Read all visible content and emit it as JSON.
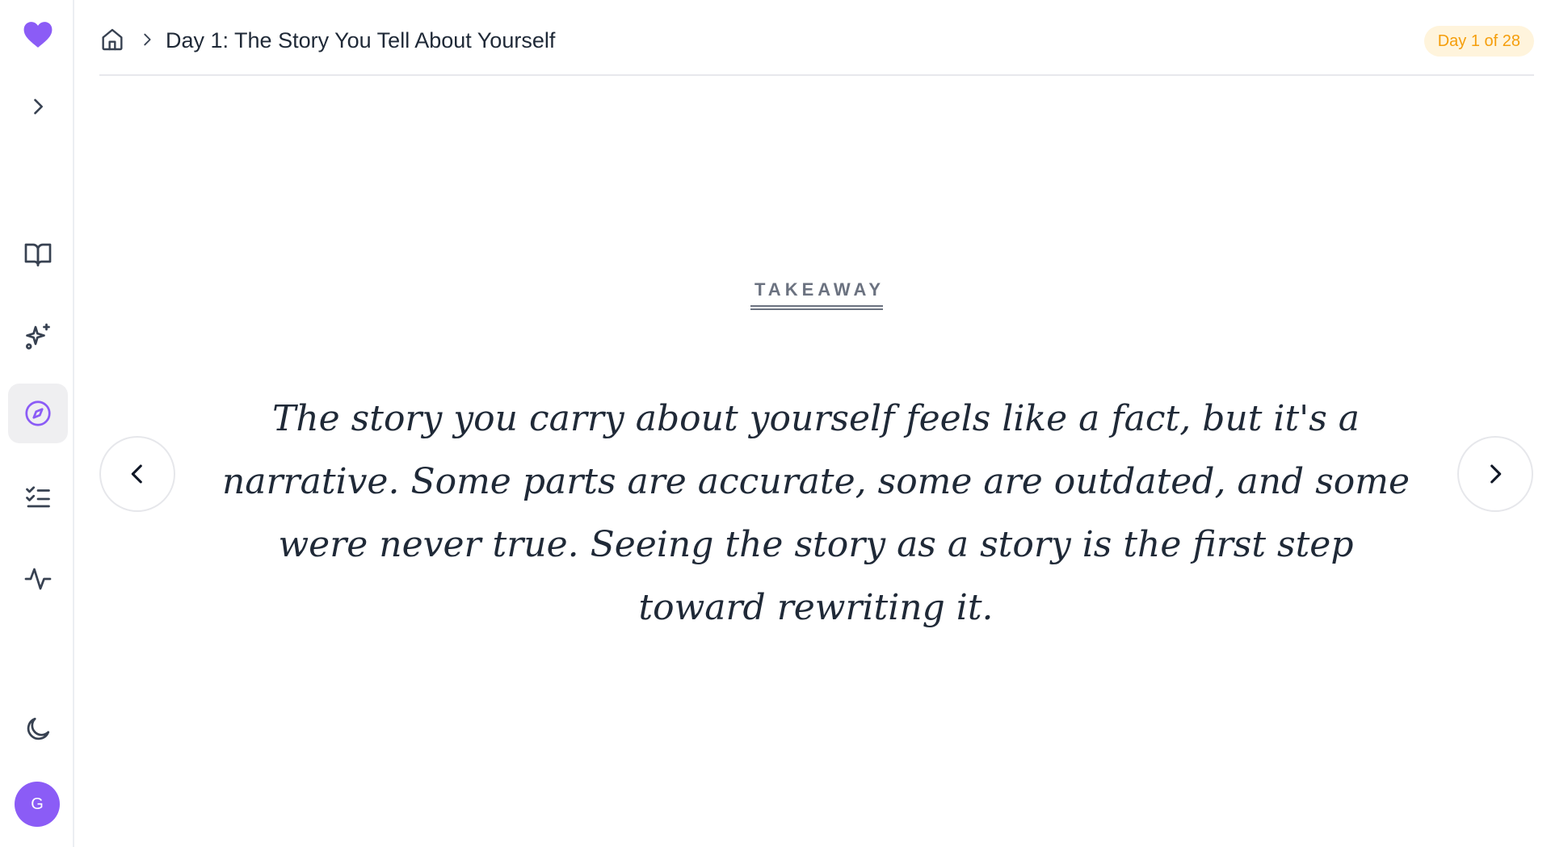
{
  "app": {
    "accent_color": "#8b5cf6",
    "logo_icon": "heart-icon"
  },
  "sidebar": {
    "expand_icon": "chevron-right-icon",
    "items": [
      {
        "name": "library",
        "icon": "book-open-icon",
        "active": false
      },
      {
        "name": "sparkles",
        "icon": "sparkles-icon",
        "active": false
      },
      {
        "name": "explore",
        "icon": "compass-icon",
        "active": true
      },
      {
        "name": "tasks",
        "icon": "list-checks-icon",
        "active": false
      },
      {
        "name": "activity",
        "icon": "activity-icon",
        "active": false
      }
    ],
    "theme_icon": "moon-icon",
    "avatar_initial": "G"
  },
  "header": {
    "home_icon": "home-icon",
    "breadcrumb_title": "Day 1: The Story You Tell About Yourself",
    "day_badge": "Day 1 of 28",
    "badge_color": "#f59e0b"
  },
  "main": {
    "section_label": "TAKEAWAY",
    "quote": "The story you carry about yourself feels like a fact, but it's a narrative. Some parts are accurate, some are outdated, and some were never true. Seeing the story as a story is the first step toward rewriting it.",
    "prev_icon": "chevron-left-icon",
    "next_icon": "chevron-right-icon"
  }
}
